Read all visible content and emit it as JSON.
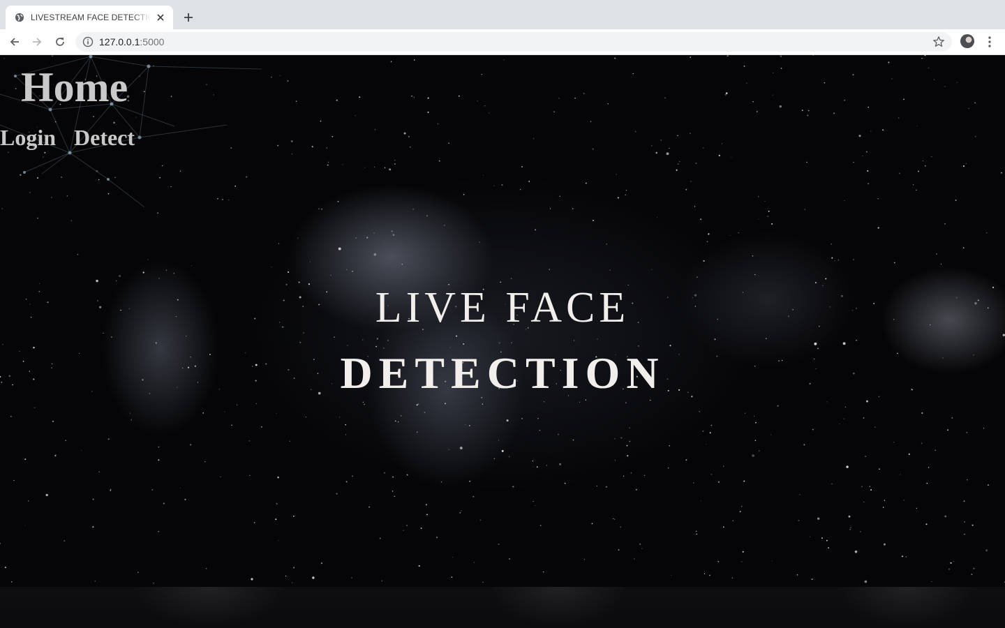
{
  "browser": {
    "tab_title": "LIVESTREAM FACE DETECTION",
    "url_host": "127.0.0.1",
    "url_port": ":5000"
  },
  "nav": {
    "home": "Home",
    "login": "Login",
    "detect": "Detect"
  },
  "hero": {
    "line1": "LIVE FACE",
    "line2": "DETECTION"
  },
  "colors": {
    "background": "#050507",
    "nav_text": "#c9c9c9",
    "hero_text": "#f2eeec"
  }
}
